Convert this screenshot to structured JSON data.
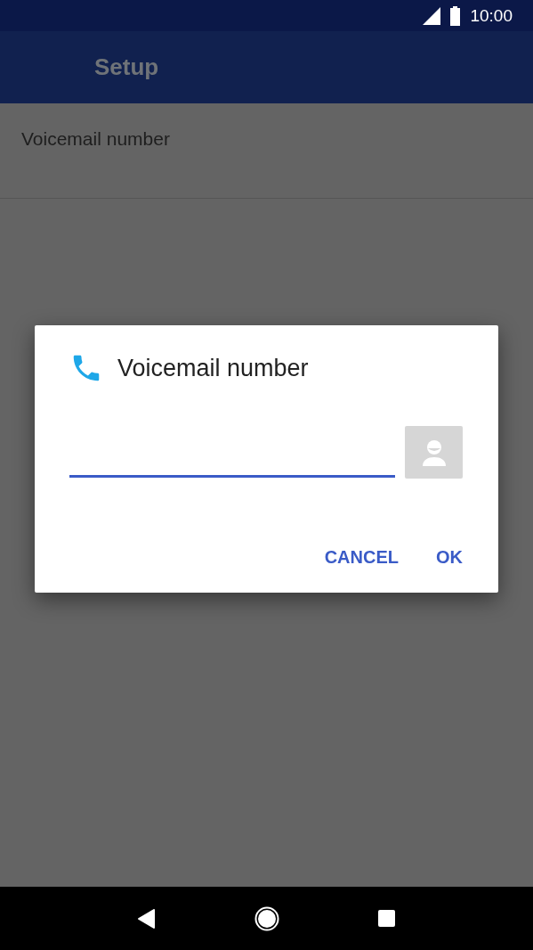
{
  "status_bar": {
    "time": "10:00"
  },
  "app_bar": {
    "title": "Setup"
  },
  "list": [
    {
      "label": "Voicemail number"
    }
  ],
  "dialog": {
    "title": "Voicemail number",
    "field": {
      "focused": true
    },
    "buttons": [
      {
        "label": "CANCEL"
      },
      {
        "label": "OK"
      }
    ]
  }
}
